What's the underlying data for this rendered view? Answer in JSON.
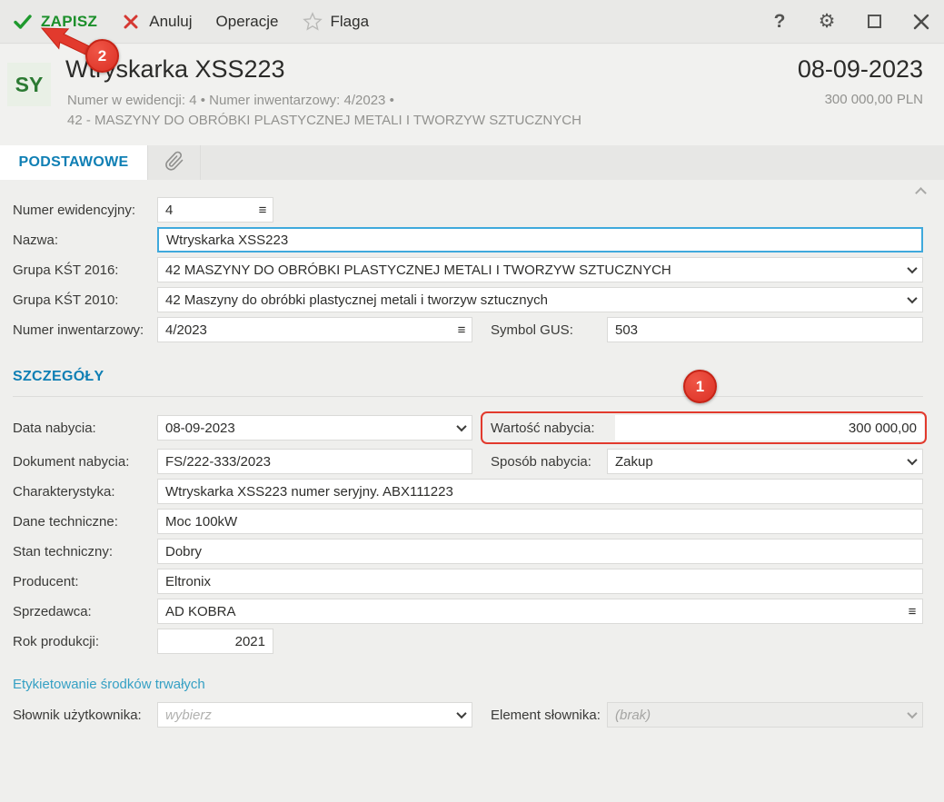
{
  "toolbar": {
    "save_label": "ZAPISZ",
    "cancel_label": "Anuluj",
    "operations_label": "Operacje",
    "flag_label": "Flaga",
    "help_label": "?",
    "icons": [
      "check-icon",
      "x-icon",
      "star-icon",
      "help-icon",
      "gear-icon",
      "maximize-icon",
      "close-icon"
    ]
  },
  "header": {
    "badge": "SY",
    "title": "Wtryskarka XSS223",
    "meta_line1": "Numer w ewidencji: 4  •  Numer inwentarzowy: 4/2023  •",
    "meta_line2": "42 - MASZYNY DO OBRÓBKI PLASTYCZNEJ METALI I TWORZYW SZTUCZNYCH",
    "date": "08-09-2023",
    "amount": "300 000,00 PLN"
  },
  "tabs": {
    "basic_label": "PODSTAWOWE",
    "attachment_tab_icon": "paperclip-icon"
  },
  "form": {
    "numer_ewidencyjny": {
      "label": "Numer ewidencyjny:",
      "value": "4"
    },
    "nazwa": {
      "label": "Nazwa:",
      "value": "Wtryskarka XSS223"
    },
    "grupa_kst_2016": {
      "label": "Grupa KŚT 2016:",
      "value": "42   MASZYNY DO OBRÓBKI PLASTYCZNEJ METALI I TWORZYW SZTUCZNYCH"
    },
    "grupa_kst_2010": {
      "label": "Grupa KŚT 2010:",
      "value": "42   Maszyny do obróbki plastycznej metali i tworzyw sztucznych"
    },
    "numer_inwentarzowy": {
      "label": "Numer inwentarzowy:",
      "value": "4/2023"
    },
    "symbol_gus": {
      "label": "Symbol GUS:",
      "value": "503"
    },
    "section_szczegoly": "SZCZEGÓŁY",
    "data_nabycia": {
      "label": "Data nabycia:",
      "value": "08-09-2023"
    },
    "wartosc_nabycia": {
      "label": "Wartość nabycia:",
      "value": "300 000,00"
    },
    "dokument_nabycia": {
      "label": "Dokument nabycia:",
      "value": "FS/222-333/2023"
    },
    "sposob_nabycia": {
      "label": "Sposób nabycia:",
      "value": "Zakup"
    },
    "charakterystyka": {
      "label": "Charakterystyka:",
      "value": "Wtryskarka XSS223 numer seryjny. ABX111223"
    },
    "dane_techniczne": {
      "label": "Dane techniczne:",
      "value": "Moc 100kW"
    },
    "stan_techniczny": {
      "label": "Stan techniczny:",
      "value": "Dobry"
    },
    "producent": {
      "label": "Producent:",
      "value": "Eltronix"
    },
    "sprzedawca": {
      "label": "Sprzedawca:",
      "value": "AD KOBRA"
    },
    "rok_produkcji": {
      "label": "Rok produkcji:",
      "value": "2021"
    },
    "link_etykietowanie": "Etykietowanie środków trwałych",
    "slownik_uzytkownika": {
      "label": "Słownik użytkownika:",
      "placeholder": "wybierz"
    },
    "element_slownika": {
      "label": "Element słownika:",
      "value": "(brak)"
    }
  },
  "annotations": {
    "step1": "1",
    "step2": "2"
  },
  "colors": {
    "save_green": "#1b8f2a",
    "cancel_red": "#d53832",
    "accent_blue": "#0f7fb4",
    "link_blue": "#35a0c4",
    "focus_border": "#3fa9dc",
    "annotation_red": "#e23a2d",
    "toolbar_bg": "#e9e9e7",
    "content_bg": "#efefed"
  }
}
